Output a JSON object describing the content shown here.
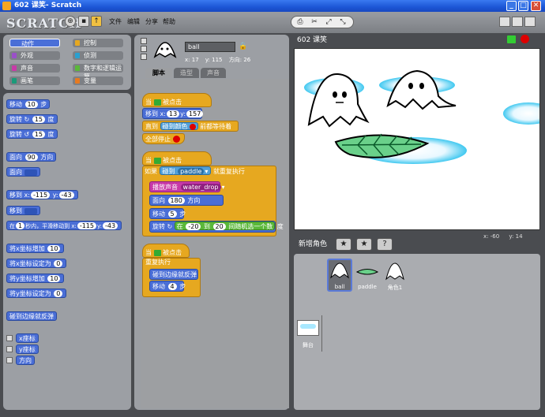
{
  "window": {
    "title": "602 课笑- Scratch"
  },
  "menu": {
    "logo": "SCRATCH",
    "items": [
      "文件",
      "编辑",
      "分享",
      "帮助"
    ]
  },
  "categories": [
    {
      "label": "动作",
      "color": "#4a6ed6",
      "selected": true
    },
    {
      "label": "控制",
      "color": "#e6a820"
    },
    {
      "label": "外观",
      "color": "#9a50c8"
    },
    {
      "label": "侦测",
      "color": "#2aa0d0"
    },
    {
      "label": "声音",
      "color": "#c83aa8"
    },
    {
      "label": "数字和逻辑运算",
      "color": "#5ab83a"
    },
    {
      "label": "画笔",
      "color": "#1a9a7a"
    },
    {
      "label": "变量",
      "color": "#e67a20"
    }
  ],
  "palette": {
    "move": "移动",
    "move_val": "10",
    "steps": "步",
    "turn_r": "旋转",
    "turn_r_val": "15",
    "degrees": "度",
    "turn_l": "旋转",
    "turn_l_val": "15",
    "point_dir": "面向",
    "point_dir_val": "90",
    "dir_word": "方向",
    "point_to": "面向",
    "goto_xy": "移到 x:",
    "goto_x": "-115",
    "y_label": "y:",
    "goto_y": "-43",
    "goto": "移到",
    "glide_pre": "在",
    "glide_secs": "1",
    "glide_mid": "秒内，平滑移动到 x:",
    "glide_x": "-115",
    "glide_y": "-43",
    "change_x": "将x坐标增加",
    "change_x_val": "10",
    "set_x": "将x坐标设定为",
    "set_x_val": "0",
    "change_y": "将y坐标增加",
    "change_y_val": "10",
    "set_y": "将y坐标设定为",
    "set_y_val": "0",
    "bounce": "碰到边缘就反弹",
    "rep_x": "x座标",
    "rep_y": "y座标",
    "rep_dir": "方向"
  },
  "sprite_info": {
    "name": "ball",
    "x_label": "x:",
    "x": "17",
    "y_label": "y:",
    "y": "115",
    "dir_label": "方向:",
    "dir": "26"
  },
  "tabs": [
    "脚本",
    "造型",
    "声音"
  ],
  "scripts": {
    "s1": {
      "hat": "当",
      "hat2": "被点击",
      "goto": "移到 x:",
      "gx": "13",
      "gy_label": "y:",
      "gy": "157",
      "until": "直到",
      "touch_color": "碰到颜色",
      "wait_end": "前都等待着",
      "stop_all": "全部停止"
    },
    "s2": {
      "hat": "当",
      "hat2": "被点击",
      "if": "如果",
      "touching": "碰到",
      "target": "paddle",
      "then": "就重复执行",
      "play": "播放声音",
      "sound": "water_drop",
      "face": "面向",
      "face_val": "180",
      "face_end": "方向",
      "move": "移动",
      "move_val": "5",
      "steps": "步",
      "rotate": "旋转",
      "at": "在",
      "rnd_lo": "-20",
      "rnd_to": "到",
      "rnd_hi": "20",
      "rnd_end": "间随机选一个数",
      "deg": "度"
    },
    "s3": {
      "hat": "当",
      "hat2": "被点击",
      "forever": "重复执行",
      "bounce": "碰到边缘就反弹",
      "move": "移动",
      "move_val": "4",
      "steps": "步"
    }
  },
  "stage": {
    "title": "602 课笑",
    "mouse_x_label": "x:",
    "mouse_x": "-60",
    "mouse_y_label": "y:",
    "mouse_y": "14"
  },
  "new_sprite": "新增角色",
  "sprites": [
    {
      "name": "ball"
    },
    {
      "name": "paddle"
    },
    {
      "name": "角色1"
    }
  ],
  "stage_label": "舞台"
}
